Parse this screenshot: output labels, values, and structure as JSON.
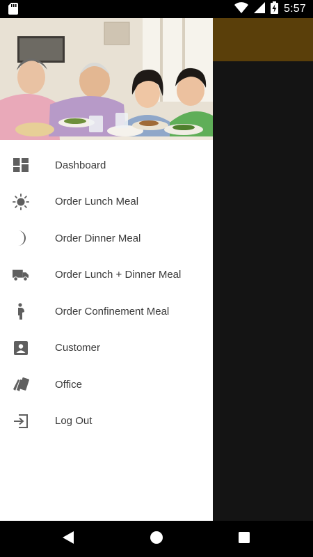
{
  "status_bar": {
    "time": "5:57",
    "icons": [
      "sd-card-icon",
      "wifi-icon",
      "cell-signal-icon",
      "battery-charging-icon"
    ]
  },
  "app": {
    "toolbar_color": "#5a3f0a"
  },
  "drawer": {
    "header_image": "family-dinner-photo",
    "items": [
      {
        "label": "Dashboard",
        "icon": "dashboard-icon"
      },
      {
        "label": "Order Lunch Meal",
        "icon": "sun-icon"
      },
      {
        "label": "Order Dinner Meal",
        "icon": "moon-icon"
      },
      {
        "label": "Order Lunch + Dinner Meal",
        "icon": "truck-icon"
      },
      {
        "label": "Order Confinement Meal",
        "icon": "pregnant-woman-icon"
      },
      {
        "label": "Customer",
        "icon": "account-box-icon"
      },
      {
        "label": "Office",
        "icon": "office-cards-icon"
      },
      {
        "label": "Log Out",
        "icon": "logout-icon"
      }
    ]
  },
  "nav_bar": {
    "buttons": [
      "back-icon",
      "home-icon",
      "recents-icon"
    ]
  }
}
